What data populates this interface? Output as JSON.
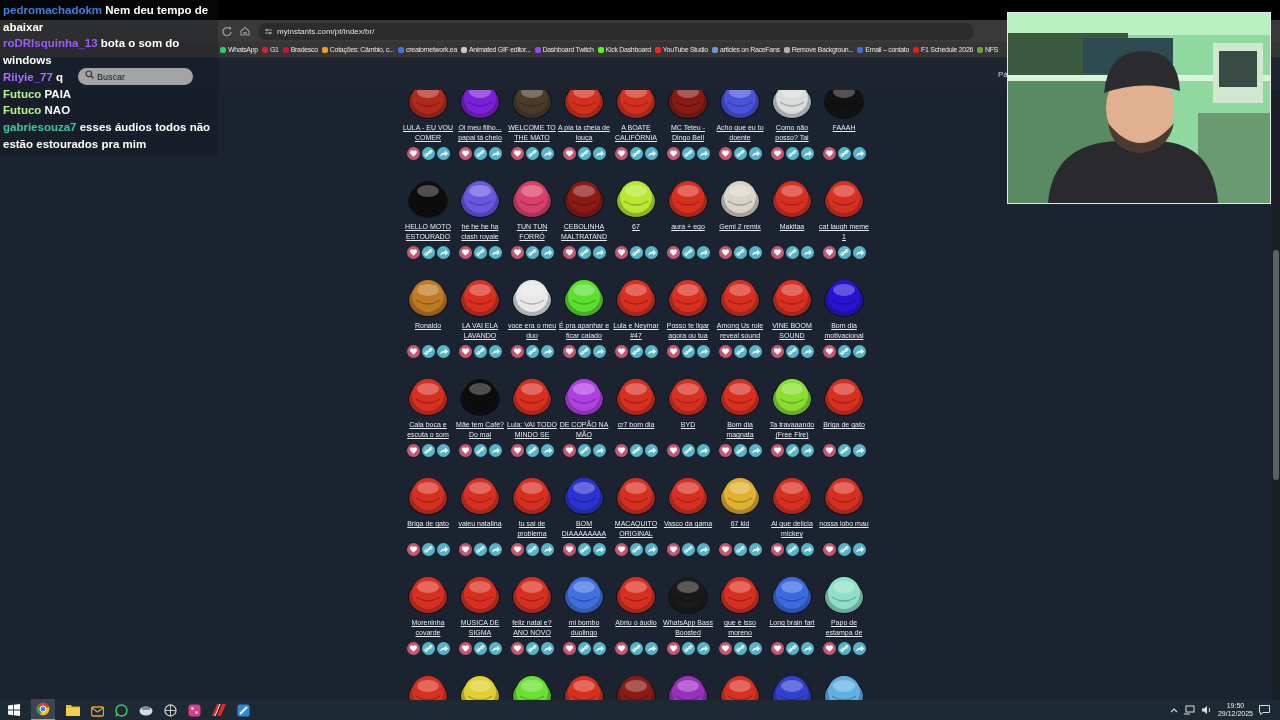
{
  "chat": [
    {
      "user": "pedromachadokm",
      "color": "#3f7fe0",
      "text": "Nem deu tempo de abaixar"
    },
    {
      "user": "roDRIsquinha_13",
      "color": "#9b5cff",
      "text": "bota o som do windows"
    },
    {
      "user": "Riiyie_77",
      "color": "#a970ff",
      "text": "q"
    },
    {
      "user": "Futuco",
      "color": "#b8f08c",
      "text": "PAIA"
    },
    {
      "user": "Futuco",
      "color": "#b8f08c",
      "text": "NAO"
    },
    {
      "user": "gabriesouza7",
      "color": "#3cc8a0",
      "text": "esses áudios todos não estão estourados pra mim"
    }
  ],
  "browser": {
    "url": "myinstants.com/pt/index/br/",
    "bookmarks": [
      {
        "label": "WhatsApp",
        "color": "#25d366"
      },
      {
        "label": "G1",
        "color": "#d8203a"
      },
      {
        "label": "Bradesco",
        "color": "#cc1133"
      },
      {
        "label": "Cotações: Câmbio, c...",
        "color": "#f0a020"
      },
      {
        "label": "creatornetwork.ea",
        "color": "#4a6ee0"
      },
      {
        "label": "Animated GIF editor...",
        "color": "#c8c8c8"
      },
      {
        "label": "Dashboard Twitch",
        "color": "#9146ff"
      },
      {
        "label": "Kick Dashboard",
        "color": "#53fc18"
      },
      {
        "label": "YouTube Studio",
        "color": "#ff2020"
      },
      {
        "label": "articles on RaceFans",
        "color": "#6a9ad0"
      },
      {
        "label": "Remove Backgroun...",
        "color": "#b0b0b0"
      },
      {
        "label": "Email – contato",
        "color": "#3a70e0"
      },
      {
        "label": "F1 Schedule 2026",
        "color": "#e02020"
      },
      {
        "label": "NFS",
        "color": "#6aa040"
      }
    ]
  },
  "page": {
    "search": {
      "placeholder": "Buscar"
    },
    "header_text": "Pá",
    "sounds": [
      {
        "label": "LULA - EU VOU COMER",
        "color": "#b02a1c"
      },
      {
        "label": "Oi meu filho... papai tá cheio",
        "color": "#7a20d8"
      },
      {
        "label": "WELCOME TO THE MATO",
        "color": "#4a3a28"
      },
      {
        "label": "A pia ta cheia de louça",
        "color": "#d2301e"
      },
      {
        "label": "A BOATE CALIFÓRNIA",
        "color": "#d2301e"
      },
      {
        "label": "MC Teteu - Dingo Bell",
        "color": "#8a1a14"
      },
      {
        "label": "Acho que eu to doente",
        "color": "#4a52d8"
      },
      {
        "label": "Como não posso? Tai",
        "color": "#d8dcdc"
      },
      {
        "label": "FAAAH",
        "color": "#111111"
      },
      {
        "label": "HELLO MOTO ESTOURADO",
        "color": "#0c0c0c"
      },
      {
        "label": "he he he ha clash royale",
        "color": "#6a56e0"
      },
      {
        "label": "TUN TUN FORRÓ",
        "color": "#d8406a"
      },
      {
        "label": "CEBOLINHA MALTRATAND",
        "color": "#8a1a14"
      },
      {
        "label": "67",
        "color": "#b8e830"
      },
      {
        "label": "aura + ego",
        "color": "#d83020"
      },
      {
        "label": "Gemi 2 remix",
        "color": "#d8d4c8"
      },
      {
        "label": "Makitaa",
        "color": "#d83020"
      },
      {
        "label": "cat laugh meme 1",
        "color": "#d83020"
      },
      {
        "label": "Ronaldo",
        "color": "#c07a22"
      },
      {
        "label": "LA VAI ELA LAVANDO",
        "color": "#d83020"
      },
      {
        "label": "voce era o meu duo",
        "color": "#e8e8e8"
      },
      {
        "label": "É pra apanhar e ficar calado",
        "color": "#5ce030"
      },
      {
        "label": "Lula e Neymar #47",
        "color": "#d83020"
      },
      {
        "label": "Posso te ligar agora ou tua",
        "color": "#d83020"
      },
      {
        "label": "Among Us role reveal sound",
        "color": "#d83020"
      },
      {
        "label": "VINE BOOM SOUND",
        "color": "#d83020"
      },
      {
        "label": "Bom dia motivacional",
        "color": "#2a12d0"
      },
      {
        "label": "Cala boca e escuta o som",
        "color": "#d83020"
      },
      {
        "label": "Mãe tem Café? Do mal",
        "color": "#0c0c0c"
      },
      {
        "label": "Lula: VAI TODO MINDO SE",
        "color": "#d83020"
      },
      {
        "label": "DE COPÃO NA MÃO",
        "color": "#b040e0"
      },
      {
        "label": "cr7 bom dia",
        "color": "#d83020"
      },
      {
        "label": "BYD",
        "color": "#d83020"
      },
      {
        "label": "Bom dia magnata",
        "color": "#d83020"
      },
      {
        "label": "Ta travaaando (Free Fire)",
        "color": "#8ae030"
      },
      {
        "label": "Briga de gato",
        "color": "#d83020"
      },
      {
        "label": "Briga de gato",
        "color": "#d83020"
      },
      {
        "label": "valeu natalina",
        "color": "#d83020"
      },
      {
        "label": "tu sai de problema",
        "color": "#d83020"
      },
      {
        "label": "BOM DIAAAAAAAA",
        "color": "#2a32d0"
      },
      {
        "label": "MACAQUITO ORIGINAL",
        "color": "#d83020"
      },
      {
        "label": "Vasco da gama",
        "color": "#d83020"
      },
      {
        "label": "67 kid",
        "color": "#e0b030"
      },
      {
        "label": "Ai que delicia mickey",
        "color": "#d83020"
      },
      {
        "label": "nossa lobo mau",
        "color": "#d83020"
      },
      {
        "label": "Moreninha covarde",
        "color": "#d83020"
      },
      {
        "label": "MUSICA DE SIGMA",
        "color": "#d83020"
      },
      {
        "label": "feliz natal e? ANO NOVO",
        "color": "#d83020"
      },
      {
        "label": "mi bombo duolingo",
        "color": "#4070e0"
      },
      {
        "label": "Abriu o áudio",
        "color": "#d83020"
      },
      {
        "label": "WhatsApp Bass Boosted",
        "color": "#1a1a1a"
      },
      {
        "label": "que é isso moreno",
        "color": "#d83020"
      },
      {
        "label": "Long brain fart",
        "color": "#3a6ae0"
      },
      {
        "label": "Papo de estampa de",
        "color": "#8ee0c8"
      },
      {
        "color": "#d83020"
      },
      {
        "color": "#e0d030"
      },
      {
        "color": "#6ae030"
      },
      {
        "color": "#d83020"
      },
      {
        "color": "#8a1a14"
      },
      {
        "color": "#9a30c0"
      },
      {
        "color": "#d83020"
      },
      {
        "color": "#3040d0"
      },
      {
        "color": "#60b0e0"
      }
    ]
  },
  "taskbar": {
    "time": "19:50",
    "date": "29/12/2025"
  }
}
